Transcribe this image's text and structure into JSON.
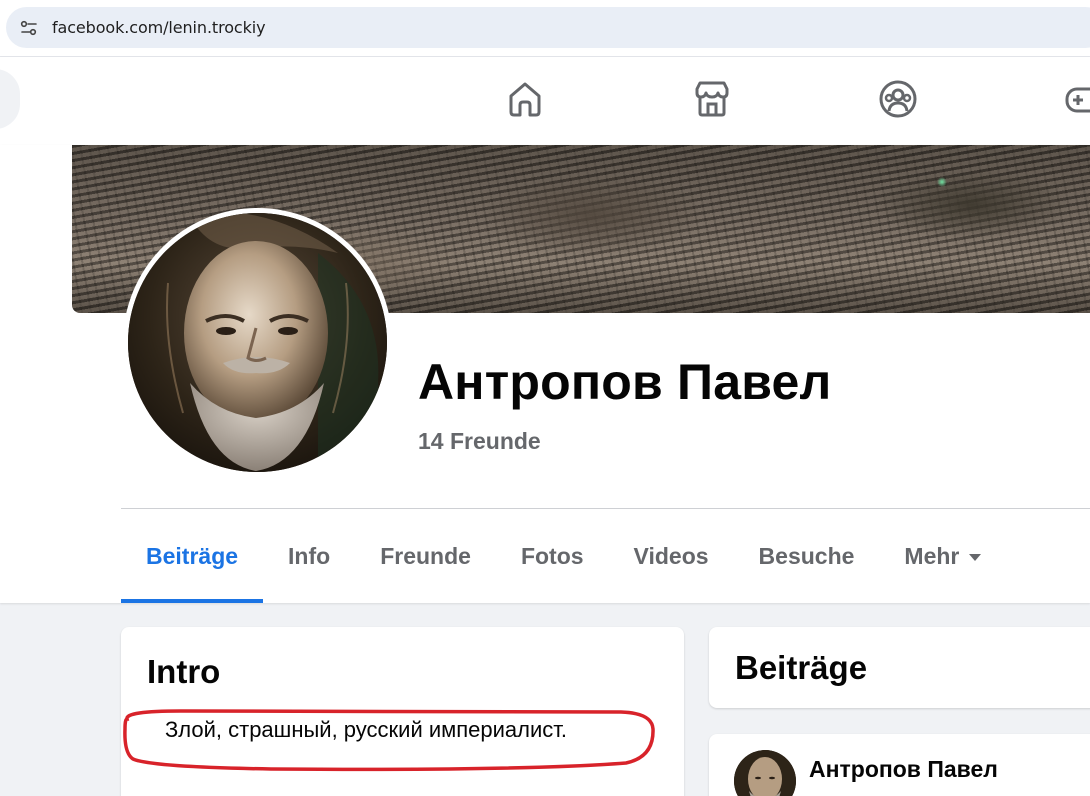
{
  "browser": {
    "url": "facebook.com/lenin.trockiy",
    "site_info_icon": "site-settings-icon"
  },
  "nav": {
    "icons": [
      "home-icon",
      "marketplace-icon",
      "groups-icon",
      "gaming-icon"
    ]
  },
  "profile": {
    "name": "Антропов Павел",
    "friends": "14 Freunde"
  },
  "tabs": [
    {
      "label": "Beiträge",
      "active": true
    },
    {
      "label": "Info",
      "active": false
    },
    {
      "label": "Freunde",
      "active": false
    },
    {
      "label": "Fotos",
      "active": false
    },
    {
      "label": "Videos",
      "active": false
    },
    {
      "label": "Besuche",
      "active": false
    },
    {
      "label": "Mehr",
      "active": false
    }
  ],
  "intro": {
    "title": "Intro",
    "bio": "Злой, страшный, русский империалист.",
    "highlight_color": "#d8232a"
  },
  "posts": {
    "title": "Beiträge",
    "author": "Антропов Павел"
  },
  "colors": {
    "accent": "#1b74e4",
    "secondary_text": "#65676b"
  }
}
